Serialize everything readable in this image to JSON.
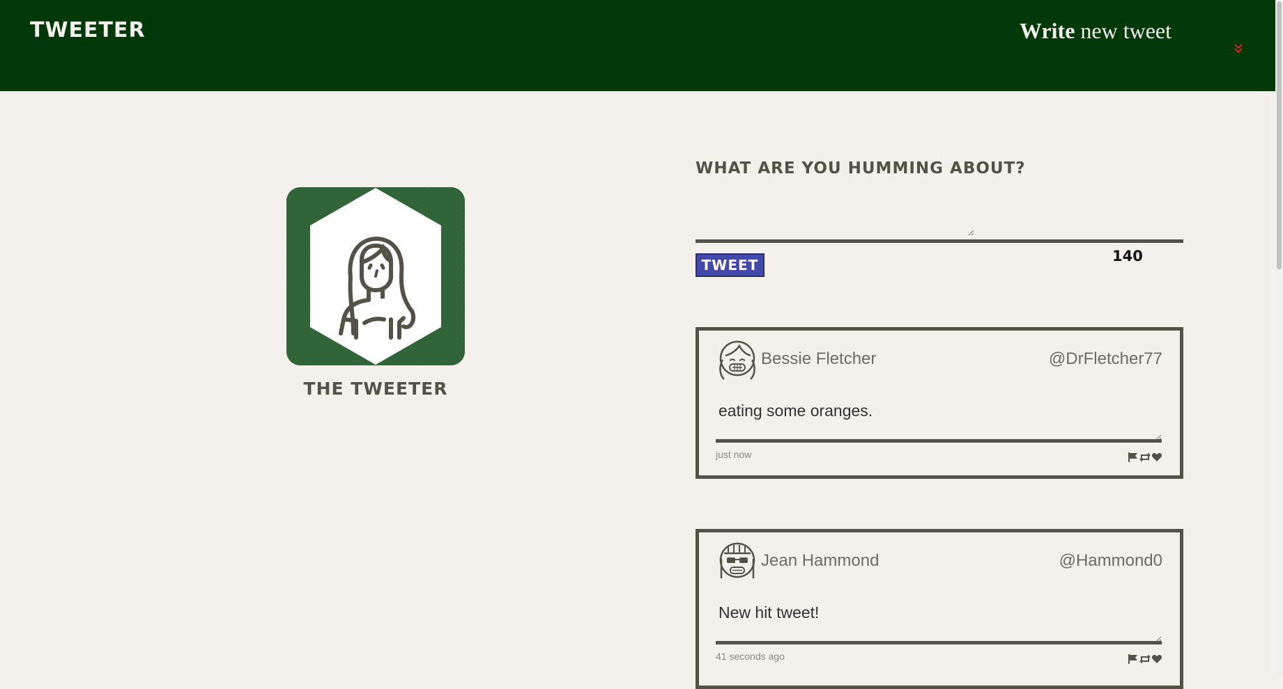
{
  "nav": {
    "brand": "Tweeter",
    "write_bold": "Write",
    "write_rest": "new tweet",
    "toggle_icon": "double-chevron-down-icon",
    "accent_color": "#003909",
    "toggle_color": "#d0281e"
  },
  "profile": {
    "avatar_icon": "woman-avatar-icon",
    "name": "The Tweeter"
  },
  "compose": {
    "title": "What are you humming about?",
    "input_value": "",
    "button_label": "Tweet",
    "button_color": "#4349a9",
    "counter": "140"
  },
  "tweets": [
    {
      "avatar_icon": "girl-with-pigtails-avatar-icon",
      "user": "Bessie Fletcher",
      "handle": "@DrFletcher77",
      "text": "eating some oranges.",
      "time": "just now",
      "actions": [
        "flag-icon",
        "retweet-icon",
        "heart-icon"
      ]
    },
    {
      "avatar_icon": "girl-with-sunglasses-avatar-icon",
      "user": "Jean Hammond",
      "handle": "@Hammond0",
      "text": "New hit tweet!",
      "time": "41 seconds ago",
      "actions": [
        "flag-icon",
        "retweet-icon",
        "heart-icon"
      ]
    }
  ]
}
